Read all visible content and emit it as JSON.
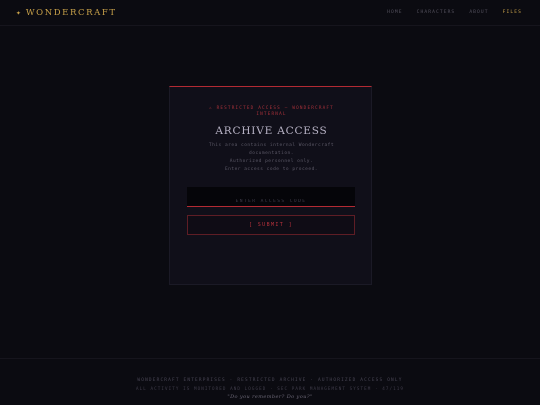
{
  "header": {
    "brand_icon": "✦",
    "brand_name": "WONDERCRAFT",
    "nav": [
      {
        "label": "HOME"
      },
      {
        "label": "CHARACTERS"
      },
      {
        "label": "ABOUT"
      },
      {
        "label": "FILES",
        "active": true
      }
    ]
  },
  "card": {
    "restricted_label": "⚠ RESTRICTED ACCESS — WONDERCRAFT INTERNAL",
    "title": "ARCHIVE ACCESS",
    "description": [
      "This area contains internal Wondercraft",
      "documentation.",
      "Authorized personnel only.",
      "Enter access code to proceed."
    ],
    "input_placeholder": "ENTER ACCESS CODE",
    "input_value": "",
    "submit_label": "[ SUBMIT ]"
  },
  "footer": {
    "line1": "WONDERCRAFT ENTERPRISES · RESTRICTED ARCHIVE · AUTHORIZED ACCESS ONLY",
    "line2": "ALL ACTIVITY IS MONITORED AND LOGGED · SEC PARK MANAGEMENT SYSTEM · 47/119",
    "line3": "\"Do you remember? Do you?\""
  },
  "colors": {
    "background": "#0b0b11",
    "accent_gold": "#c9a24a",
    "accent_red": "#b32a33"
  }
}
